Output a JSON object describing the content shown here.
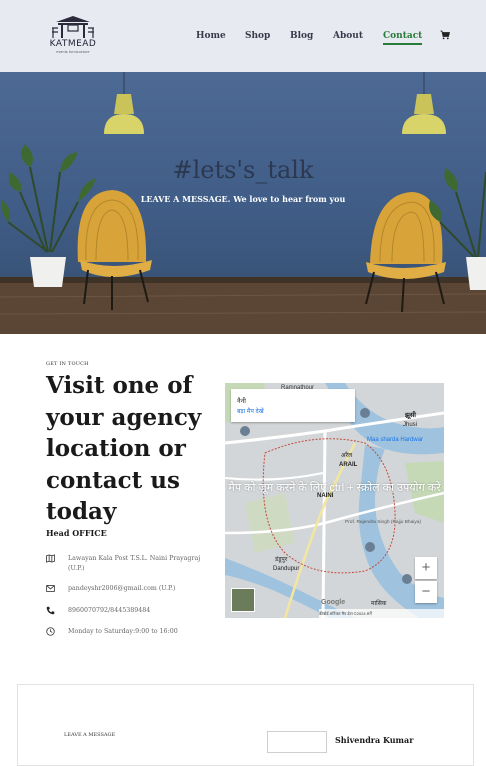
{
  "brand": {
    "name": "KATMEAD",
    "tagline": "events furnicucture"
  },
  "nav": {
    "items": [
      "Home",
      "Shop",
      "Blog",
      "About",
      "Contact"
    ],
    "active": "Contact",
    "cart_icon": "cart-icon"
  },
  "hero": {
    "title": "#lets's_talk",
    "subtitle": "LEAVE A MESSAGE. We love to hear from you"
  },
  "contact": {
    "eyebrow": "GET IN TOUCH",
    "title": "Visit one of your agency location or contact us today",
    "head_office": "Head OFFICE",
    "address": "Lawayan Kala Post T.S.L. Naini Prayagraj (U.P.)",
    "email": "pandeyshr2006@gmail.com (U.P.)",
    "phone": "8960070792/8445389484",
    "hours": "Monday to Saturday:9:00 to 16:00",
    "icons": [
      "map-icon",
      "envelope-icon",
      "phone-icon",
      "clock-icon"
    ]
  },
  "map": {
    "place": "नैनी",
    "bigger_map": "बड़ा मैप देखें",
    "hint": "मैप को ज़ूम करने के लिए ctrl + स्क्रोल का उपयोग करें",
    "zoom_in": "+",
    "zoom_out": "−",
    "provider": "Google",
    "footer": "कीबोर्ड शॉर्टकट   मैप डेटा ©2024   शर्तें",
    "labels": [
      "Ramnathpur",
      "झूसी",
      "Jhusi",
      "Maa sharda Hardwar",
      "अरैल",
      "ARAIL",
      "NAINI",
      "डंडूपुर",
      "Dandupur",
      "मासिक",
      "Prof. Rajendra Singh (Rajju Bhaiya)"
    ]
  },
  "bottom": {
    "eyebrow": "LEAVE A MESSAGE",
    "name": "Shivendra Kumar"
  },
  "colors": {
    "header_bg": "#e8eaf2",
    "active_nav": "#2a7a3a",
    "hero_wall": "#4d6a94"
  }
}
